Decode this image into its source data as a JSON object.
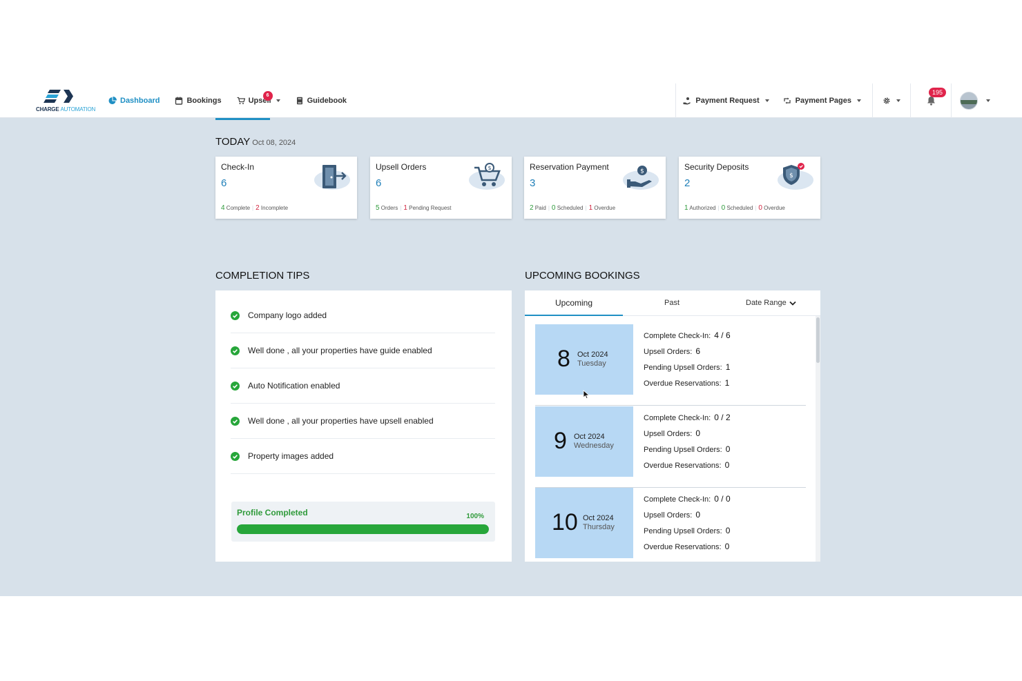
{
  "nav": {
    "logo_line1": "CHARGE",
    "logo_line2": "AUTOMATION",
    "items": [
      {
        "label": "Dashboard"
      },
      {
        "label": "Bookings"
      },
      {
        "label": "Upsell",
        "badge": "6"
      },
      {
        "label": "Guidebook"
      }
    ],
    "right": {
      "payment_request": "Payment Request",
      "payment_pages": "Payment Pages",
      "notifications": "195"
    }
  },
  "today": {
    "title": "TODAY",
    "date": "Oct 08, 2024",
    "cards": [
      {
        "title": "Check-In",
        "value": "6",
        "metrics": [
          {
            "n": "4",
            "label": "Complete"
          },
          {
            "n": "2",
            "label": "Incomplete"
          }
        ]
      },
      {
        "title": "Upsell Orders",
        "value": "6",
        "metrics": [
          {
            "n": "5",
            "label": "Orders"
          },
          {
            "n": "1",
            "label": "Pending Request"
          }
        ]
      },
      {
        "title": "Reservation Payment",
        "value": "3",
        "metrics": [
          {
            "n": "2",
            "label": "Paid"
          },
          {
            "n": "0",
            "label": "Scheduled"
          },
          {
            "n": "1",
            "label": "Overdue"
          }
        ]
      },
      {
        "title": "Security Deposits",
        "value": "2",
        "metrics": [
          {
            "n": "1",
            "label": "Authorized"
          },
          {
            "n": "0",
            "label": "Scheduled"
          },
          {
            "n": "0",
            "label": "Overdue"
          }
        ]
      }
    ]
  },
  "completion": {
    "title": "COMPLETION TIPS",
    "tips": [
      "Company logo added",
      "Well done , all your properties have guide enabled",
      "Auto Notification enabled",
      "Well done , all your properties have upsell enabled",
      "Property images added"
    ],
    "progress_label": "Profile Completed",
    "progress_text": "100%",
    "progress_value": 100
  },
  "upcoming": {
    "title": "UPCOMING BOOKINGS",
    "tabs": [
      "Upcoming",
      "Past"
    ],
    "date_range": "Date Range",
    "stat_labels": {
      "checkin": "Complete Check-In:",
      "upsell": "Upsell Orders:",
      "pending": "Pending Upsell Orders:",
      "overdue": "Overdue Reservations:"
    },
    "days": [
      {
        "day": "8",
        "month": "Oct 2024",
        "weekday": "Tuesday",
        "checkin": "4 / 6",
        "upsell": "6",
        "pending": "1",
        "overdue": "1"
      },
      {
        "day": "9",
        "month": "Oct 2024",
        "weekday": "Wednesday",
        "checkin": "0 / 2",
        "upsell": "0",
        "pending": "0",
        "overdue": "0"
      },
      {
        "day": "10",
        "month": "Oct 2024",
        "weekday": "Thursday",
        "checkin": "0 / 0",
        "upsell": "0",
        "pending": "0",
        "overdue": "0"
      }
    ]
  },
  "colors": {
    "accent": "#1f8fc4",
    "success": "#27a63a",
    "danger": "#e0244b",
    "day_box": "#b7d8f4",
    "background": "#d7e1ea"
  }
}
